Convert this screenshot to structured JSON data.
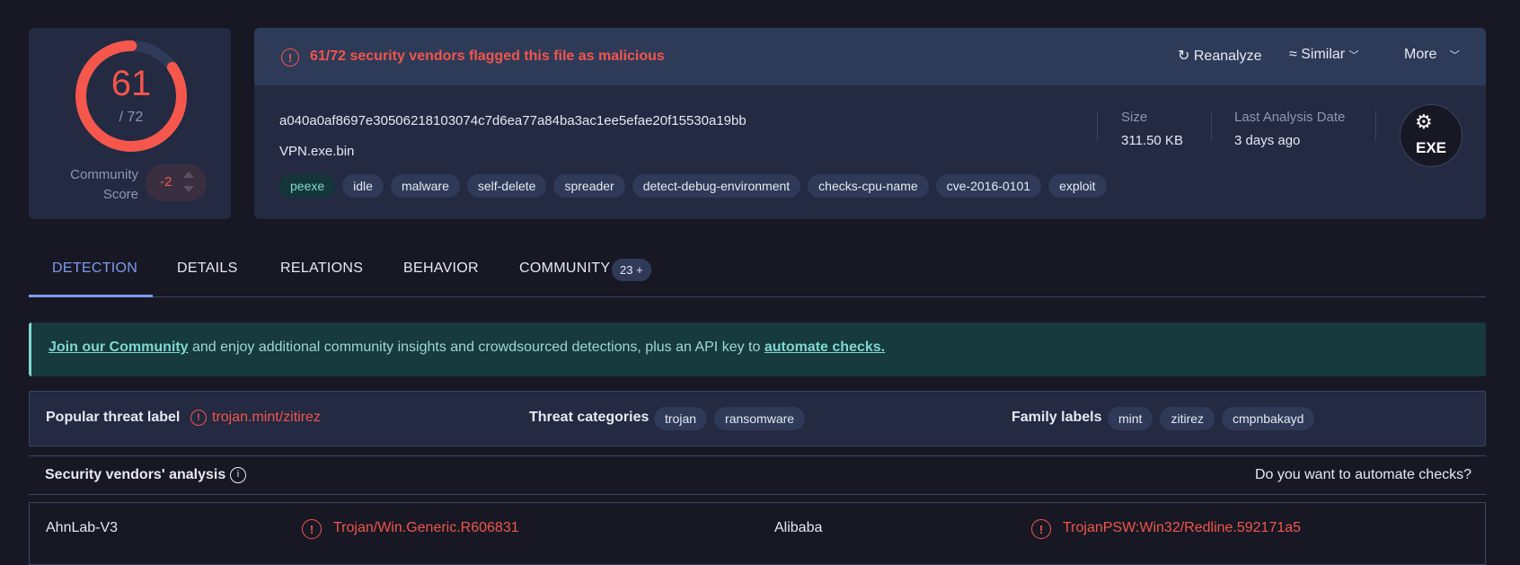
{
  "score": {
    "detections": "61",
    "total": "/ 72",
    "detected_count": 61,
    "total_count": 72,
    "community_label_1": "Community",
    "community_label_2": "Score",
    "community_value": "-2"
  },
  "header": {
    "alert": "61/72 security vendors flagged this file as malicious",
    "reanalyze": "Reanalyze",
    "similar": "Similar",
    "more": "More"
  },
  "file": {
    "hash": "a040a0af8697e30506218103074c7d6ea77a84ba3ac1ee5efae20f15530a19bb",
    "name": "VPN.exe.bin",
    "tags": [
      "peexe",
      "idle",
      "malware",
      "self-delete",
      "spreader",
      "detect-debug-environment",
      "checks-cpu-name",
      "cve-2016-0101",
      "exploit"
    ],
    "size_label": "Size",
    "size_value": "311.50 KB",
    "date_label": "Last Analysis Date",
    "date_value": "3 days ago",
    "type_icon_text": "EXE"
  },
  "tabs": [
    {
      "label": "DETECTION"
    },
    {
      "label": "DETAILS"
    },
    {
      "label": "RELATIONS"
    },
    {
      "label": "BEHAVIOR"
    },
    {
      "label": "COMMUNITY",
      "badge": "23 +"
    }
  ],
  "banner": {
    "link1": "Join our Community",
    "middle": " and enjoy additional community insights and crowdsourced detections, plus an API key to ",
    "link2": "automate checks."
  },
  "threat": {
    "popular_label": "Popular threat label",
    "popular_value": "trojan.mint/zitirez",
    "categories_label": "Threat categories",
    "categories": [
      "trojan",
      "ransomware"
    ],
    "family_label": "Family labels",
    "families": [
      "mint",
      "zitirez",
      "cmpnbakayd"
    ]
  },
  "vendors": {
    "title": "Security vendors' analysis",
    "automate": "Do you want to automate checks?",
    "rows": [
      {
        "vendor1": "AhnLab-V3",
        "result1": "Trojan/Win.Generic.R606831",
        "vendor2": "Alibaba",
        "result2": "TrojanPSW:Win32/Redline.592171a5"
      }
    ]
  },
  "colors": {
    "accent": "#7b9cf0",
    "danger": "#f1554c",
    "teal": "#7fd8cf"
  }
}
